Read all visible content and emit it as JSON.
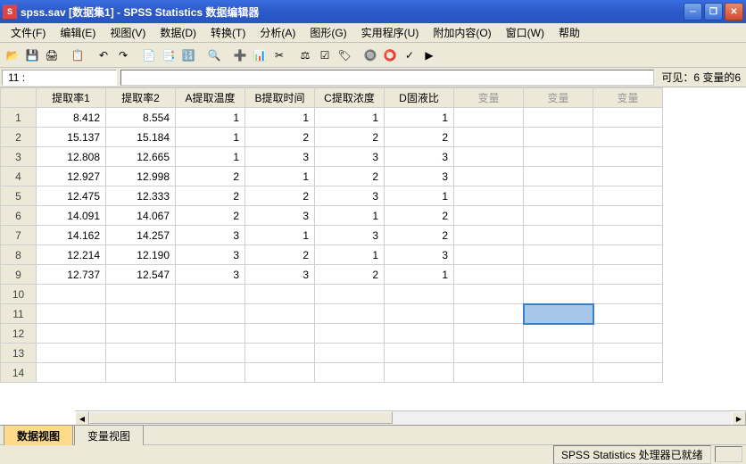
{
  "title": "spss.sav [数据集1] - SPSS Statistics 数据编辑器",
  "menu": {
    "file": "文件(F)",
    "edit": "编辑(E)",
    "view": "视图(V)",
    "data": "数据(D)",
    "transform": "转换(T)",
    "analyze": "分析(A)",
    "graphs": "图形(G)",
    "utilities": "实用程序(U)",
    "addons": "附加内容(O)",
    "window": "窗口(W)",
    "help": "帮助"
  },
  "cellref": {
    "label": "11 :",
    "status": "可见：6 变量的6"
  },
  "columns": [
    "提取率1",
    "提取率2",
    "A提取温度",
    "B提取时间",
    "C提取浓度",
    "D固液比",
    "变量",
    "变量",
    "变量"
  ],
  "chart_data": {
    "type": "table",
    "columns": [
      "提取率1",
      "提取率2",
      "A提取温度",
      "B提取时间",
      "C提取浓度",
      "D固液比"
    ],
    "rows": [
      [
        8.412,
        8.554,
        1,
        1,
        1,
        1
      ],
      [
        15.137,
        15.184,
        1,
        2,
        2,
        2
      ],
      [
        12.808,
        12.665,
        1,
        3,
        3,
        3
      ],
      [
        12.927,
        12.998,
        2,
        1,
        2,
        3
      ],
      [
        12.475,
        12.333,
        2,
        2,
        3,
        1
      ],
      [
        14.091,
        14.067,
        2,
        3,
        1,
        2
      ],
      [
        14.162,
        14.257,
        3,
        1,
        3,
        2
      ],
      [
        12.214,
        12.19,
        3,
        2,
        1,
        3
      ],
      [
        12.737,
        12.547,
        3,
        3,
        2,
        1
      ]
    ]
  },
  "selected": {
    "row": 11,
    "col": 7
  },
  "tabs": {
    "data": "数据视图",
    "var": "变量视图"
  },
  "status": {
    "ready": "SPSS Statistics 处理器已就绪"
  }
}
